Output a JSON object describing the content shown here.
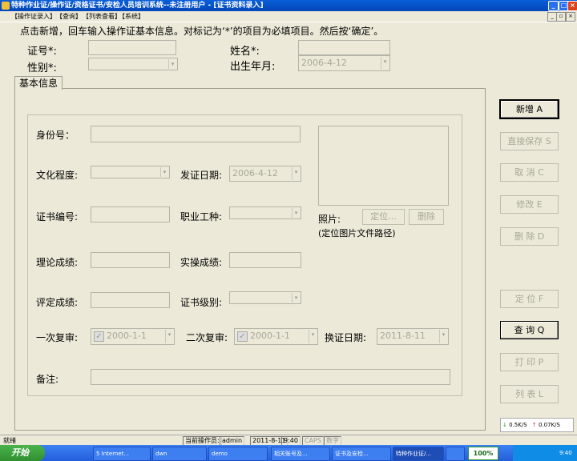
{
  "window": {
    "title": "特种作业证/操作证/资格证书/安检人员培训系统--未注册用户 - [证书资料录入]",
    "controls": [
      "_",
      "□",
      "×"
    ]
  },
  "menu": [
    "【操作证录入】",
    "【查询】",
    "【列表查看】",
    "【系统】"
  ],
  "hint": "点击新增，回车输入操作证基本信息。对标记为‘*’的项目为必填项目。然后按‘确定’。",
  "top_form": {
    "cert_no_label": "证号*:",
    "name_label": "姓名*:",
    "gender_label": "性别*:",
    "birth_label": "出生年月:",
    "birth_value": "2006-4-12"
  },
  "tab_label": "基本信息",
  "form": {
    "id_label": "身份号：",
    "edu_label": "文化程度:",
    "issue_date_label": "发证日期:",
    "issue_date_value": "2006-4-12",
    "cert_num_label": "证书编号:",
    "job_label": "职业工种:",
    "theory_label": "理论成绩:",
    "practice_label": "实操成绩:",
    "eval_label": "评定成绩:",
    "level_label": "证书级别:",
    "review1_label": "一次复审:",
    "review1_value": "2000-1-1",
    "review2_label": "二次复审:",
    "review2_value": "2000-1-1",
    "renew_label": "换证日期:",
    "renew_value": "2011-8-11",
    "remark_label": "备注:",
    "photo_label": "照片:",
    "locate_button": "定位...",
    "delete_photo_button": "删除",
    "photo_hint": "(定位图片文件路径)"
  },
  "buttons": [
    {
      "label": "新增 A",
      "enabled": true
    },
    {
      "label": "直接保存 S",
      "enabled": false
    },
    {
      "label": "取 消 C",
      "enabled": false
    },
    {
      "label": "修改 E",
      "enabled": false
    },
    {
      "label": "删 除 D",
      "enabled": false
    },
    {
      "label": "定 位 F",
      "enabled": false
    },
    {
      "label": "查 询 Q",
      "enabled": true
    },
    {
      "label": "打 印 P",
      "enabled": false
    },
    {
      "label": "列 表 L",
      "enabled": false
    }
  ],
  "network_widget": {
    "down": "0.5K/S",
    "up": "0.07K/S"
  },
  "statusbar": {
    "left": "就绪",
    "operator_label": "当前操作员:",
    "operator": "admin",
    "date": "2011-8-11",
    "time": "9:40",
    "caps": "CAPS",
    "num": "数字"
  },
  "taskbar": {
    "start": "开始",
    "tasks": [
      "5 Internet...",
      "dwn",
      "demo",
      "相关账号及...",
      "证书及安检...",
      "特种作业证/...",
      ""
    ],
    "zoom": "100%",
    "clock": "9:40"
  }
}
